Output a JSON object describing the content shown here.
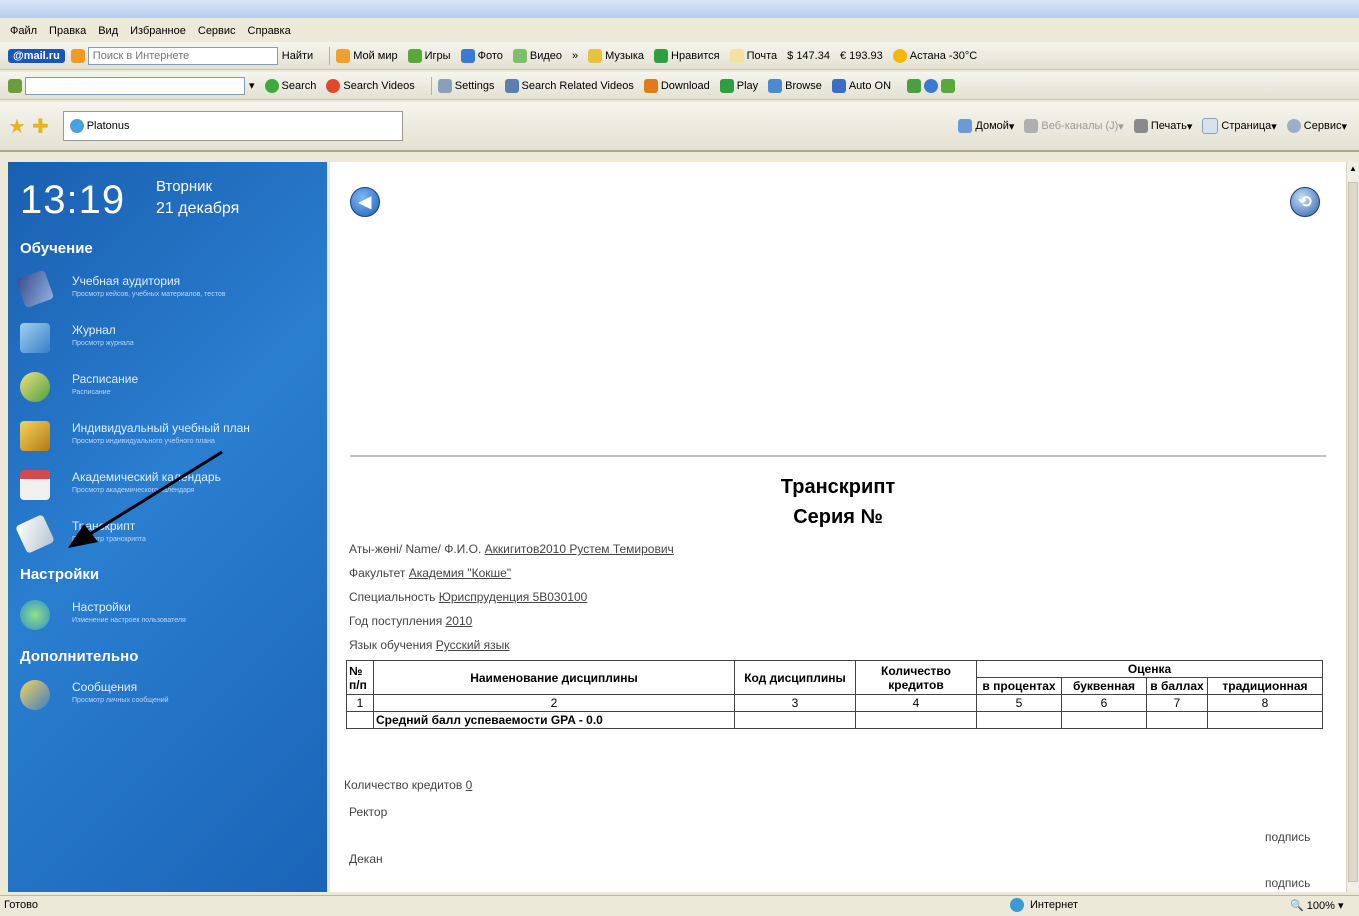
{
  "menu": [
    "Файл",
    "Правка",
    "Вид",
    "Избранное",
    "Сервис",
    "Справка"
  ],
  "toolbar_mail": {
    "logo": "@mail.ru",
    "search_placeholder": "Поиск в Интернете",
    "find": "Найти",
    "items": [
      "Мой мир",
      "Игры",
      "Фото",
      "Видео",
      "»",
      "Музыка",
      "Нравится",
      "Почта"
    ],
    "usd": "$ 147.34",
    "eur": "€ 193.93",
    "weather": "Астана -30°C"
  },
  "toolbar_search": {
    "items": [
      "Search",
      "Search Videos",
      "Settings",
      "Search Related Videos",
      "Download",
      "Play",
      "Browse",
      "Auto ON"
    ]
  },
  "tabs": {
    "page_title": "Platonus",
    "commands": [
      "Домой",
      "Веб-каналы (J)",
      "Печать",
      "Страница",
      "Сервис"
    ]
  },
  "sidebar": {
    "time": "13:19",
    "weekday": "Вторник",
    "date": "21 декабря",
    "sections": [
      {
        "title": "Обучение"
      },
      {
        "title": "Настройки"
      },
      {
        "title": "Дополнительно"
      }
    ],
    "items": [
      {
        "label": "Учебная аудитория",
        "sub": "Просмотр кейсов, учебных материалов, тестов"
      },
      {
        "label": "Журнал",
        "sub": "Просмотр журнала"
      },
      {
        "label": "Расписание",
        "sub": "Расписание"
      },
      {
        "label": "Индивидуальный учебный план",
        "sub": "Просмотр индивидуального учебного плана"
      },
      {
        "label": "Академический календарь",
        "sub": "Просмотр академического календаря"
      },
      {
        "label": "Транскрипт",
        "sub": "Просмотр транскрипта"
      },
      {
        "label": "Настройки",
        "sub": "Изменение настроек пользователя"
      },
      {
        "label": "Сообщения",
        "sub": "Просмотр личных сообщений"
      }
    ]
  },
  "document": {
    "title": "Транскрипт",
    "series": "Серия №",
    "fields": [
      {
        "label": "Аты-жөні/ Name/ Ф.И.О.",
        "value": "Аккигитов2010 Рустем Темирович"
      },
      {
        "label": "Факультет",
        "value": "Академия \"Кокше\""
      },
      {
        "label": "Специальность",
        "value": "Юриспруденция 5В030100"
      },
      {
        "label": "Год поступления",
        "value": "2010"
      },
      {
        "label": "Язык обучения",
        "value": "Русский язык"
      }
    ],
    "table": {
      "h_num": "№ п/п",
      "h_name": "Наименование дисциплины",
      "h_code": "Код дисциплины",
      "h_credits": "Количество кредитов",
      "h_grade": "Оценка",
      "h_percent": "в процентах",
      "h_letter": "буквенная",
      "h_points": "в баллах",
      "h_trad": "традиционная",
      "nums": [
        "1",
        "2",
        "3",
        "4",
        "5",
        "6",
        "7",
        "8"
      ],
      "gpa": "Средний балл успеваемости GPA - 0.0"
    },
    "credits_label": "Количество кредитов",
    "credits_value": "0",
    "rector": "Ректор",
    "dean": "Декан",
    "signature": "подпись"
  },
  "status": {
    "left": "Готово",
    "zone": "Интернет",
    "zoom": "100%"
  }
}
